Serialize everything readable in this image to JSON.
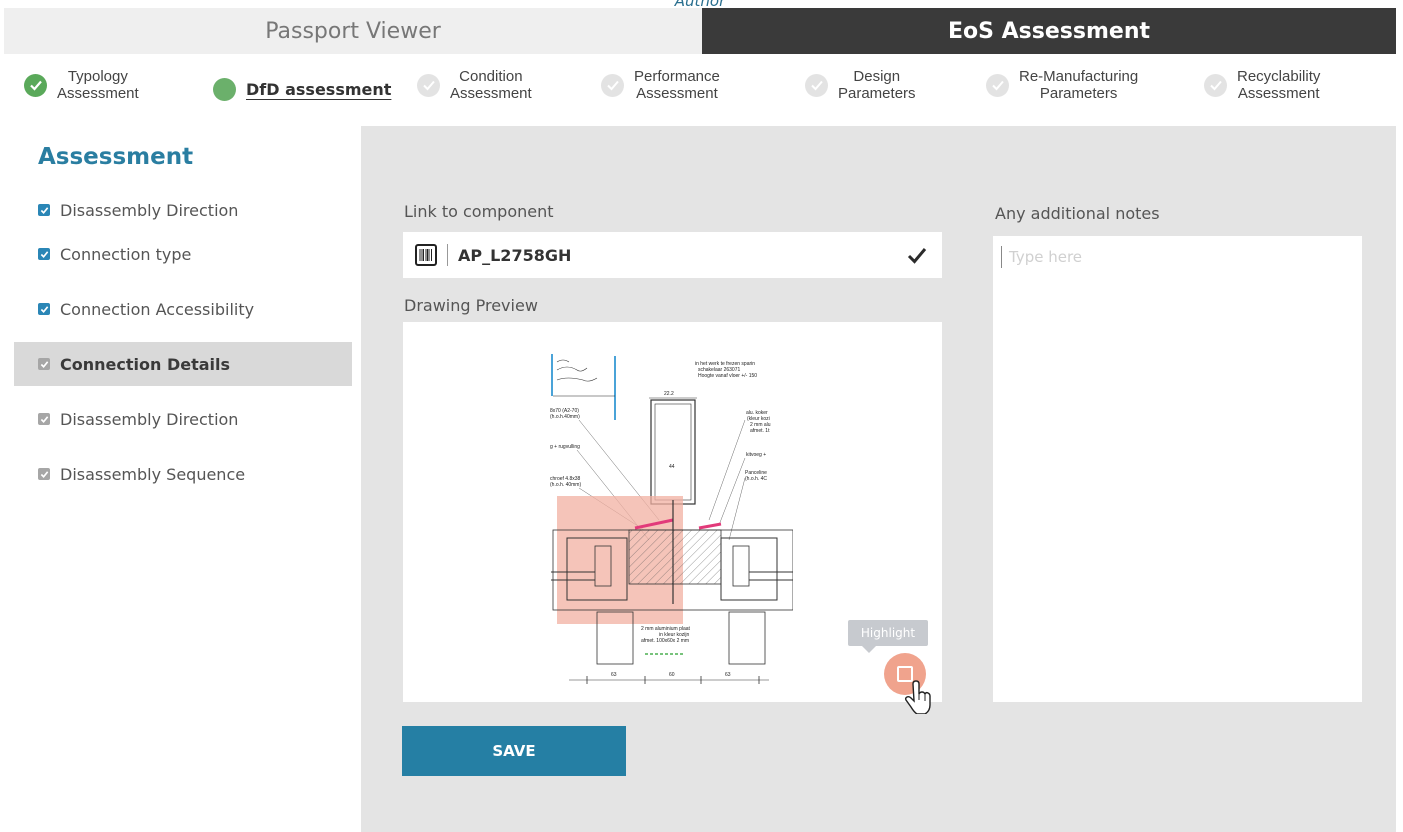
{
  "author_caption": "Author",
  "mode_tabs": [
    {
      "label": "Passport Viewer"
    },
    {
      "label": "EoS Assessment"
    }
  ],
  "steps": [
    {
      "line1": "Typology",
      "line2": "Assessment",
      "state": "done"
    },
    {
      "line1": "DfD assessment",
      "line2": "",
      "state": "active"
    },
    {
      "line1": "Condition",
      "line2": "Assessment",
      "state": "pending"
    },
    {
      "line1": "Performance",
      "line2": "Assessment",
      "state": "pending"
    },
    {
      "line1": "Design",
      "line2": "Parameters",
      "state": "pending"
    },
    {
      "line1": "Re-Manufacturing",
      "line2": "Parameters",
      "state": "pending"
    },
    {
      "line1": "Recyclability",
      "line2": "Assessment",
      "state": "pending"
    }
  ],
  "sidebar": {
    "title": "Assessment",
    "items": [
      {
        "label": "Disassembly Direction",
        "checkbox": "blue",
        "selected": false
      },
      {
        "label": "Connection type",
        "checkbox": "blue",
        "selected": false
      },
      {
        "label": "Connection Accessibility",
        "checkbox": "blue",
        "selected": false
      },
      {
        "label": "Connection Details",
        "checkbox": "grey",
        "selected": true
      },
      {
        "label": "Disassembly Direction",
        "checkbox": "grey",
        "selected": false
      },
      {
        "label": "Disassembly Sequence",
        "checkbox": "grey",
        "selected": false
      }
    ]
  },
  "main": {
    "link_label": "Link to component",
    "link_value": "AP_L2758GH",
    "preview_label": "Drawing Preview",
    "notes_label": "Any additional notes",
    "notes_placeholder": "Type here",
    "highlight_tooltip": "Highlight",
    "save_label": "SAVE"
  },
  "drawing_text": {
    "note1": "in het werk te frezen sparin",
    "note2": "schakelaar 263071",
    "note3": "Hoogte vanaf vloer +/- 150",
    "dim_top": "22.2",
    "left1": "8x70 (A2-70)",
    "left2": "(h.o.h.40mm)",
    "left3": "g + rugvulling",
    "left4": "chroef 4.8x38",
    "left5": "(h.o.h. 40mm)",
    "right1": "alu. koker",
    "right2": "(kleur kozi",
    "right3": "2 mm alu",
    "right4": "afmet. 1t",
    "right5": "kitvoeg +",
    "right6": "Panceline",
    "right7": "(h.o.h. 4C",
    "mid_dim": "44",
    "bottom1": "2 mm aluminium plaat",
    "bottom2": "in kleur kozijn",
    "bottom3": "afmet. 100x60x 2 mm",
    "dim_b1": "63",
    "dim_b2": "60",
    "dim_b3": "63"
  },
  "colors": {
    "accent_blue": "#2a7ea1",
    "save_blue": "#257fa4",
    "step_done_green": "#5aa95a",
    "dark_tab": "#3a3a3a",
    "highlight_salmon": "#f0a38d"
  }
}
